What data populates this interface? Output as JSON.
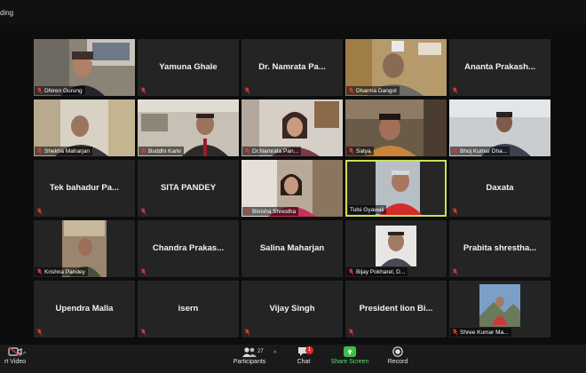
{
  "header": {
    "recording_label": "ding"
  },
  "tiles": [
    {
      "name": "Dhiren Gurung",
      "muted": true,
      "video": true
    },
    {
      "name": "Yamuna Ghale",
      "muted": true,
      "video": false
    },
    {
      "name": "Dr. Namrata Pa...",
      "muted": true,
      "video": false
    },
    {
      "name": "Dharma Dangol",
      "muted": true,
      "video": true
    },
    {
      "name": "Ananta Prakash...",
      "muted": true,
      "video": false
    },
    {
      "name": "Shekha Maharjan",
      "muted": true,
      "video": true
    },
    {
      "name": "Buddhi Karki",
      "muted": true,
      "video": true
    },
    {
      "name": "Dr.Namrata Pan...",
      "muted": true,
      "video": true
    },
    {
      "name": "Satya",
      "muted": true,
      "video": true
    },
    {
      "name": "Bhoj Kumar Dha...",
      "muted": true,
      "video": true
    },
    {
      "name": "Tek bahadur Pa...",
      "muted": true,
      "video": false
    },
    {
      "name": "SITA PANDEY",
      "muted": true,
      "video": false
    },
    {
      "name": "Binisha Shrestha",
      "muted": true,
      "video": true
    },
    {
      "name": "Tulsi Gyawali",
      "muted": false,
      "video": true,
      "active_speaker": true
    },
    {
      "name": "Daxata",
      "muted": true,
      "video": false
    },
    {
      "name": "Krishna Pandey",
      "muted": true,
      "video": true
    },
    {
      "name": "Chandra  Prakas...",
      "muted": true,
      "video": false
    },
    {
      "name": "Salina Maharjan",
      "muted": true,
      "video": false
    },
    {
      "name": "Bijay Pokharel, D...",
      "muted": true,
      "video": true
    },
    {
      "name": "Prabita  shrestha...",
      "muted": true,
      "video": false
    },
    {
      "name": "Upendra Malla",
      "muted": true,
      "video": false
    },
    {
      "name": "isern",
      "muted": true,
      "video": false
    },
    {
      "name": "Vijay Singh",
      "muted": true,
      "video": false
    },
    {
      "name": "President  lion  Bi...",
      "muted": true,
      "video": false
    },
    {
      "name": "Shree Kumar Ma...",
      "muted": true,
      "video": true
    }
  ],
  "toolbar": {
    "start_video": "rt Video",
    "participants_label": "Participants",
    "participants_count": "27",
    "chat_label": "Chat",
    "chat_badge": "1",
    "share_label": "Share Screen",
    "record_label": "Record"
  },
  "colors": {
    "active_border": "#c9e05a",
    "muted_icon": "#e0343a",
    "share_green": "#3bbf4b",
    "tile_bg": "#242424"
  },
  "icons": [
    "microphone-muted-icon",
    "video-off-icon",
    "participants-icon",
    "chat-icon",
    "share-screen-icon",
    "record-icon",
    "caret-up-icon"
  ]
}
